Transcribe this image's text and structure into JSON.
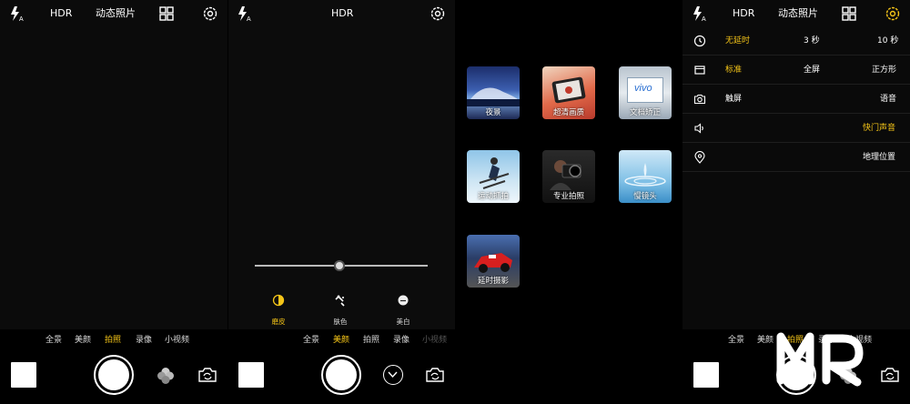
{
  "top_bar": {
    "hdr": "HDR",
    "live_photo": "动态照片"
  },
  "modes": [
    "全景",
    "美颜",
    "拍照",
    "录像",
    "小视频"
  ],
  "panel1": {
    "active_mode": 2
  },
  "panel2": {
    "active_mode": 1,
    "slider_value_fraction": 0.49,
    "beauty_options": [
      {
        "label": "磨皮",
        "active": true
      },
      {
        "label": "肤色",
        "active": false
      },
      {
        "label": "美白",
        "active": false
      }
    ]
  },
  "panel3": {
    "tiles": [
      {
        "label": "夜景"
      },
      {
        "label": "超清画质"
      },
      {
        "label": "文档矫正"
      },
      {
        "label": "运动抓拍"
      },
      {
        "label": "专业拍照"
      },
      {
        "label": "慢镜头"
      },
      {
        "label": "延时摄影"
      }
    ],
    "vivo_text": "vivo"
  },
  "panel4": {
    "active_mode": 2,
    "rows": [
      {
        "icon": "timer-icon",
        "options": [
          "无延时",
          "3 秒",
          "10 秒"
        ],
        "active": 0
      },
      {
        "icon": "aspect-ratio-icon",
        "options": [
          "标准",
          "全屏",
          "正方形"
        ],
        "active": 0
      },
      {
        "icon": "camera-icon",
        "options": [
          "触屏",
          "语音"
        ],
        "active": -1
      },
      {
        "icon": "speaker-icon",
        "options": [
          "快门声音"
        ],
        "active": 0
      },
      {
        "icon": "location-icon",
        "options": [
          "地理位置"
        ],
        "active": -1
      }
    ]
  },
  "colors": {
    "accent": "#f5c518",
    "background": "#0b0b0b"
  }
}
